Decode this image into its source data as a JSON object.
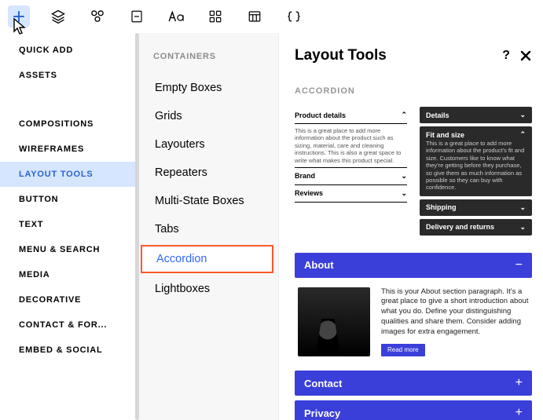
{
  "toolbar": {
    "icons": [
      "plus",
      "layers",
      "shapes",
      "page",
      "text",
      "grid",
      "table",
      "braces"
    ]
  },
  "sidebar": {
    "groups": [
      {
        "items": [
          {
            "label": "Quick Add"
          },
          {
            "label": "Assets"
          }
        ]
      },
      {
        "items": [
          {
            "label": "Compositions"
          },
          {
            "label": "Wireframes"
          },
          {
            "label": "Layout Tools",
            "selected": true
          },
          {
            "label": "Button"
          },
          {
            "label": "Text"
          },
          {
            "label": "Menu & Search"
          },
          {
            "label": "Media"
          },
          {
            "label": "Decorative"
          },
          {
            "label": "Contact & For..."
          },
          {
            "label": "Embed & Social"
          }
        ]
      }
    ]
  },
  "mid": {
    "heading": "Containers",
    "items": [
      {
        "label": "Empty Boxes"
      },
      {
        "label": "Grids"
      },
      {
        "label": "Layouters"
      },
      {
        "label": "Repeaters"
      },
      {
        "label": "Multi-State Boxes"
      },
      {
        "label": "Tabs"
      },
      {
        "label": "Accordion",
        "highlight": true
      },
      {
        "label": "Lightboxes"
      }
    ]
  },
  "right": {
    "title": "Layout Tools",
    "section": "Accordion",
    "light": {
      "r1": "Product details",
      "body": "This is a great place to add more information about the product such as sizing, material, care and cleaning instructions. This is also a great space to write what makes this product special.",
      "r2": "Brand",
      "r3": "Reviews"
    },
    "dark": {
      "r1": "Details",
      "r2": "Fit and size",
      "body": "This is a great place to add more information about the product's fit and size. Customers like to know what they're getting before they purchase, so give them as much information as possible so they can buy with confidence.",
      "r3": "Shipping",
      "r4": "Delivery and returns"
    },
    "blue": {
      "about": "About",
      "aboutBody": "This is your About section paragraph. It's a great place to give a short introduction about what you do. Define your distinguishing qualities and share them. Consider adding images for extra engagement.",
      "readmore": "Read more",
      "contact": "Contact",
      "privacy": "Privacy"
    }
  }
}
